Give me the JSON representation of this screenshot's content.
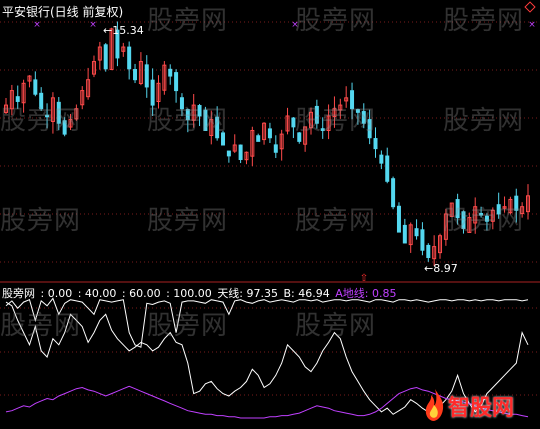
{
  "title": "平安银行(日线 前复权)",
  "price_labels": {
    "high": "15.34",
    "low": "8.97"
  },
  "indicator": {
    "name": "股旁网",
    "levels": [
      ": 0.00",
      ": 40.00",
      ": 60.00",
      ": 100.00"
    ],
    "sky_label": "天线: 97.35",
    "b_label": "B: 46.94",
    "a_label": "A地线: 0.85"
  },
  "watermark_text": "股旁网",
  "logo_text": "智股网",
  "colors": {
    "background": "#000000",
    "up_candle": "#ff4a4a",
    "down_candle": "#54d8f0",
    "sky_line": "#ffffff",
    "a_line": "#c040ff",
    "b_label": "#ffffff",
    "levels": "#ffffff",
    "marker": "#c040ff"
  },
  "chart_data": {
    "type": "candlestick",
    "price_range": [
      8.6,
      15.6
    ],
    "high_value": 15.34,
    "low_value": 8.97,
    "candles_close": [
      13.2,
      13.6,
      13.3,
      13.8,
      14.0,
      13.5,
      13.1,
      12.9,
      13.4,
      12.7,
      12.4,
      12.8,
      13.1,
      13.6,
      13.9,
      14.4,
      14.8,
      14.2,
      15.3,
      14.5,
      14.8,
      14.2,
      13.9,
      14.4,
      13.7,
      13.2,
      13.8,
      14.3,
      14.0,
      13.6,
      13.1,
      12.8,
      13.2,
      12.9,
      12.5,
      12.8,
      12.3,
      12.1,
      11.8,
      12.1,
      11.7,
      11.9,
      12.5,
      12.2,
      12.7,
      12.3,
      11.9,
      12.4,
      12.9,
      12.6,
      12.2,
      12.6,
      13.0,
      12.7,
      12.5,
      12.9,
      13.1,
      13.2,
      13.4,
      13.1,
      13.0,
      12.7,
      12.3,
      12.0,
      11.6,
      11.1,
      10.4,
      9.7,
      9.4,
      9.9,
      9.6,
      9.2,
      9.0,
      9.3,
      9.6,
      10.2,
      10.5,
      10.1,
      9.8,
      10.1,
      10.4,
      10.2,
      10.0,
      10.3,
      10.2,
      10.4,
      10.6,
      10.3,
      10.4,
      10.7
    ],
    "sky_line": [
      92,
      96,
      90,
      95,
      97,
      80,
      96,
      92,
      98,
      85,
      94,
      97,
      96,
      95,
      90,
      85,
      97,
      96,
      95,
      96,
      97,
      70,
      60,
      58,
      94,
      93,
      95,
      96,
      94,
      70,
      95,
      96,
      96,
      95,
      94,
      97,
      96,
      95,
      85,
      96,
      97,
      95,
      94,
      96,
      97,
      95,
      96,
      97,
      96,
      95,
      97,
      97,
      96,
      97,
      95,
      96,
      97,
      97,
      96,
      97,
      97,
      96,
      95,
      97,
      97,
      96,
      95,
      97,
      97,
      96,
      97,
      96,
      95,
      96,
      97,
      97,
      96,
      97,
      97,
      96,
      97,
      96,
      97,
      97,
      96,
      97,
      97,
      97,
      96,
      97
    ],
    "b_line": [
      95,
      92,
      80,
      70,
      60,
      75,
      55,
      50,
      65,
      60,
      70,
      85,
      80,
      75,
      62,
      70,
      80,
      85,
      72,
      65,
      60,
      55,
      58,
      62,
      60,
      55,
      58,
      65,
      70,
      62,
      60,
      45,
      20,
      22,
      28,
      30,
      24,
      20,
      18,
      22,
      25,
      30,
      40,
      35,
      25,
      28,
      35,
      45,
      60,
      55,
      50,
      42,
      38,
      45,
      55,
      62,
      70,
      65,
      50,
      38,
      30,
      22,
      15,
      10,
      5,
      8,
      3,
      6,
      9,
      15,
      12,
      8,
      5,
      7,
      10,
      15,
      22,
      35,
      20,
      12,
      5,
      10,
      20,
      25,
      30,
      35,
      40,
      45,
      70,
      60
    ],
    "a_line": [
      5,
      6,
      8,
      10,
      9,
      12,
      14,
      16,
      15,
      18,
      20,
      22,
      24,
      25,
      23,
      22,
      20,
      18,
      20,
      22,
      24,
      26,
      24,
      22,
      20,
      18,
      16,
      14,
      12,
      10,
      8,
      6,
      5,
      4,
      3,
      3,
      2,
      2,
      1,
      1,
      0,
      0,
      0,
      0,
      0,
      1,
      1,
      2,
      2,
      3,
      4,
      6,
      8,
      10,
      9,
      8,
      6,
      5,
      4,
      3,
      2,
      2,
      3,
      5,
      8,
      12,
      16,
      20,
      22,
      24,
      25,
      23,
      22,
      20,
      18,
      16,
      15,
      14,
      13,
      12,
      10,
      8,
      7,
      6,
      5,
      4,
      3,
      3,
      2,
      1
    ]
  }
}
